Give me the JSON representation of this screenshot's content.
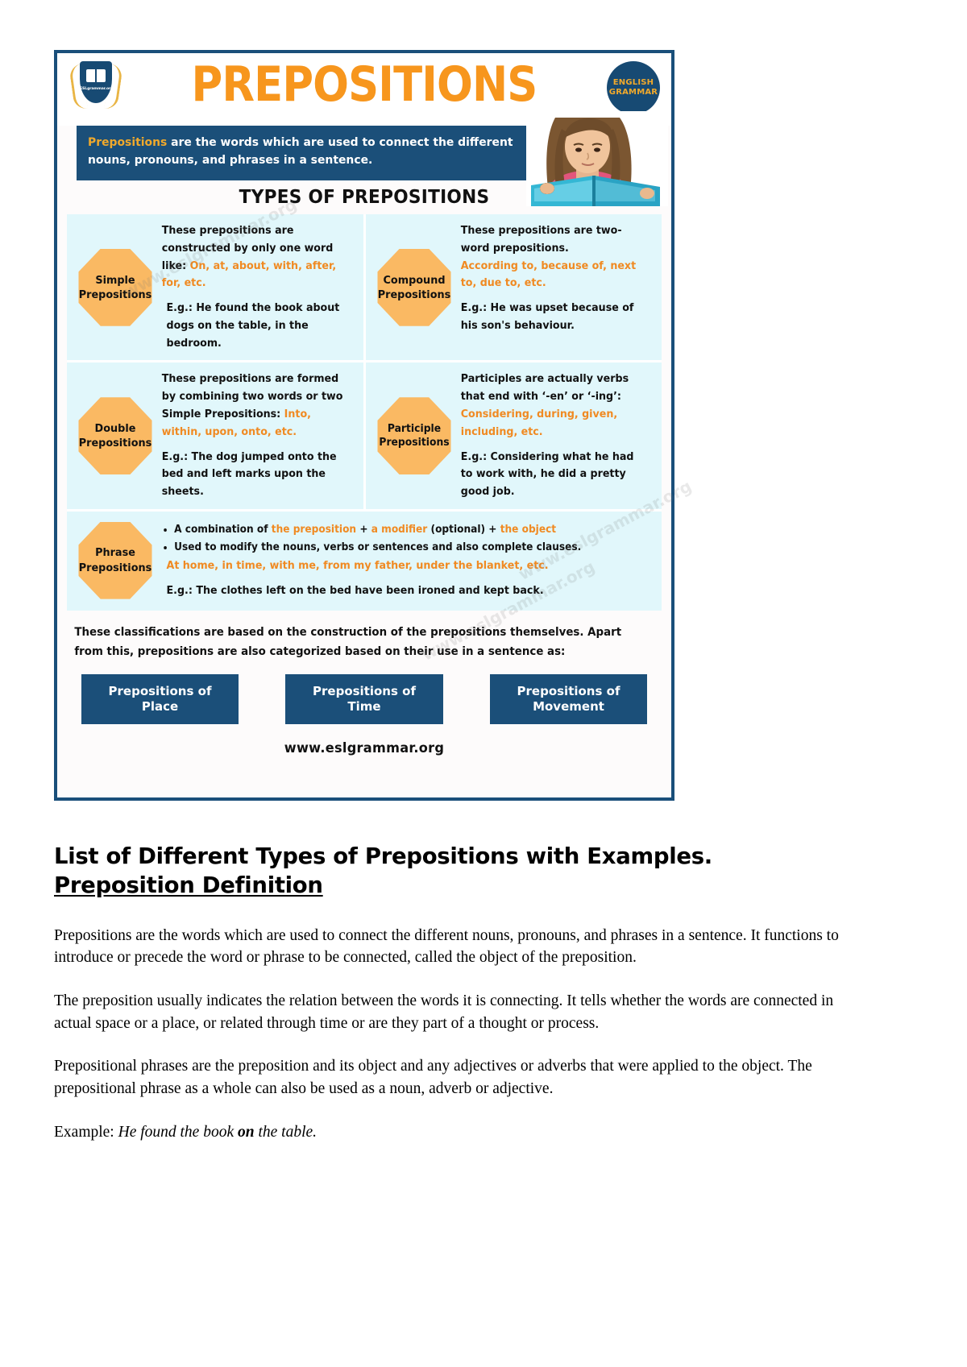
{
  "infographic": {
    "logo": {
      "shield_text": "ESLgrammar.org",
      "icon": "open-book-icon"
    },
    "badge": {
      "line1": "ENGLISH",
      "line2": "GRAMMAR"
    },
    "title": "PREPOSITIONS",
    "definition": {
      "highlight": "Prepositions",
      "rest": " are the words which are used to connect the different nouns, pronouns, and phrases in a sentence."
    },
    "types_heading": "TYPES OF PREPOSITIONS",
    "watermarks": [
      "www.eslgrammar.org",
      "www.eslgrammar.org",
      "www.eslgrammar.org"
    ],
    "cards": [
      {
        "name": "Simple\nPrepositions",
        "label_line1": "Simple",
        "label_line2": "Prepositions",
        "desc_plain": "These prepositions are constructed by only one word like: ",
        "desc_orange": "On, at, about, with, after, for, etc.",
        "example": "E.g.: He found the book about dogs on the table, in the bedroom."
      },
      {
        "name": "Compound Prepositions",
        "label_line1": "Compound",
        "label_line2": "Prepositions",
        "desc_plain": "These prepositions are two-word prepositions.",
        "desc_orange": "According to, because of, next to, due to, etc.",
        "example": "E.g.: He was upset because of his son's behaviour."
      },
      {
        "name": "Double Prepositions",
        "label_line1": "Double",
        "label_line2": "Prepositions",
        "desc_plain": "These prepositions are formed by combining two words or two Simple Prepositions: ",
        "desc_orange": "Into, within, upon, onto, etc.",
        "example": "E.g.: The dog jumped onto the bed and left marks upon the sheets."
      },
      {
        "name": "Participle Prepositions",
        "label_line1": "Participle",
        "label_line2": "Prepositions",
        "desc_plain": "Participles are actually verbs that end with ‘-en’ or ‘-ing’: ",
        "desc_orange": "Considering, during, given, including, etc.",
        "example": "E.g.: Considering what he had to work with, he did a pretty good job."
      }
    ],
    "phrase_card": {
      "label_line1": "Phrase",
      "label_line2": "Prepositions",
      "bullet1": {
        "a": "A combination of ",
        "b": "the preposition",
        "c": " + ",
        "d": "a modifier",
        "e": " (optional) + ",
        "f": "the object"
      },
      "bullet2": "Used to modify the nouns, verbs or sentences and also complete clauses.",
      "orange_examples": "At home, in time, with me, from my father, under the blanket, etc.",
      "example": "E.g.: The clothes left on the bed have been ironed and kept back."
    },
    "footer_note": "These classifications are based on the construction of the prepositions themselves. Apart from this, prepositions are also categorized based on their use in a sentence as:",
    "pills": [
      "Prepositions of Place",
      "Prepositions of Time",
      "Prepositions of Movement"
    ],
    "site_url": "www.eslgrammar.org"
  },
  "article": {
    "title_line1": "List of Different Types of Prepositions with Examples.",
    "title_line2": "Preposition Definition",
    "paragraphs": [
      "Prepositions are the words which are used to connect the different nouns, pronouns, and phrases in a sentence. It functions to introduce or precede the word or phrase to be connected, called the object of the preposition.",
      "The preposition usually indicates the relation between the words it is connecting. It tells whether the words are connected in actual space or a place, or related through time or are they part of a thought or process.",
      "Prepositional phrases are the preposition and its object and any adjectives or adverbs that were applied to the object. The prepositional phrase as a whole can also be used as a noun, adverb or adjective."
    ],
    "example_label": "Example: ",
    "example_italic_a": "He found the book ",
    "example_bold": "on",
    "example_italic_b": " the table."
  },
  "colors": {
    "navy": "#1b4f79",
    "orange": "#f7961d",
    "octagon": "#fab963",
    "card_bg": "#e1f7fb",
    "accent_text": "#f08a22"
  }
}
